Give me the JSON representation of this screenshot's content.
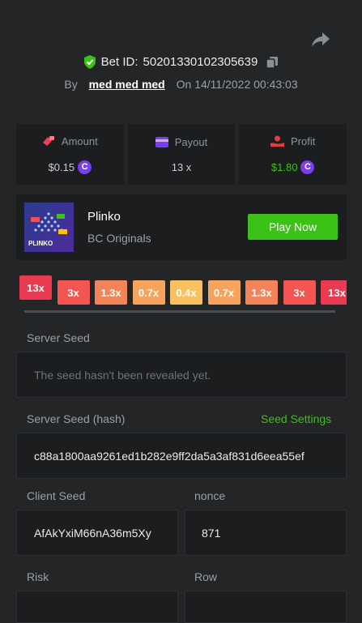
{
  "header": {
    "bet_id_label": "Bet ID:",
    "bet_id": "50201330102305639",
    "by_label": "By",
    "username": "med med med",
    "on_label": "On",
    "datetime": "14/11/2022 00:43:03"
  },
  "stats": {
    "amount_label": "Amount",
    "amount_value": "$0.15",
    "payout_label": "Payout",
    "payout_value": "13 x",
    "profit_label": "Profit",
    "profit_value": "$1.80",
    "coin_symbol": "C"
  },
  "game": {
    "name": "Plinko",
    "provider": "BC Originals",
    "play_label": "Play Now",
    "thumb_label": "PLINKO"
  },
  "multipliers": [
    "13x",
    "3x",
    "1.3x",
    "0.7x",
    "0.4x",
    "0.7x",
    "1.3x",
    "3x",
    "13x"
  ],
  "seeds": {
    "server_seed_label": "Server Seed",
    "server_seed_placeholder": "The seed hasn't been revealed yet.",
    "server_hash_label": "Server Seed (hash)",
    "seed_settings_label": "Seed Settings",
    "server_hash": "c88a1800aa9261ed1b282e9ff2da5a3af831d6eea55ef",
    "client_seed_label": "Client Seed",
    "client_seed": "AfAkYxiM66nA36m5Xy",
    "nonce_label": "nonce",
    "nonce": "871",
    "risk_label": "Risk",
    "row_label": "Row"
  },
  "colors": {
    "accent_green": "#3bc117",
    "profit_green": "#3bc117",
    "coin_purple": "#7b3df0"
  }
}
